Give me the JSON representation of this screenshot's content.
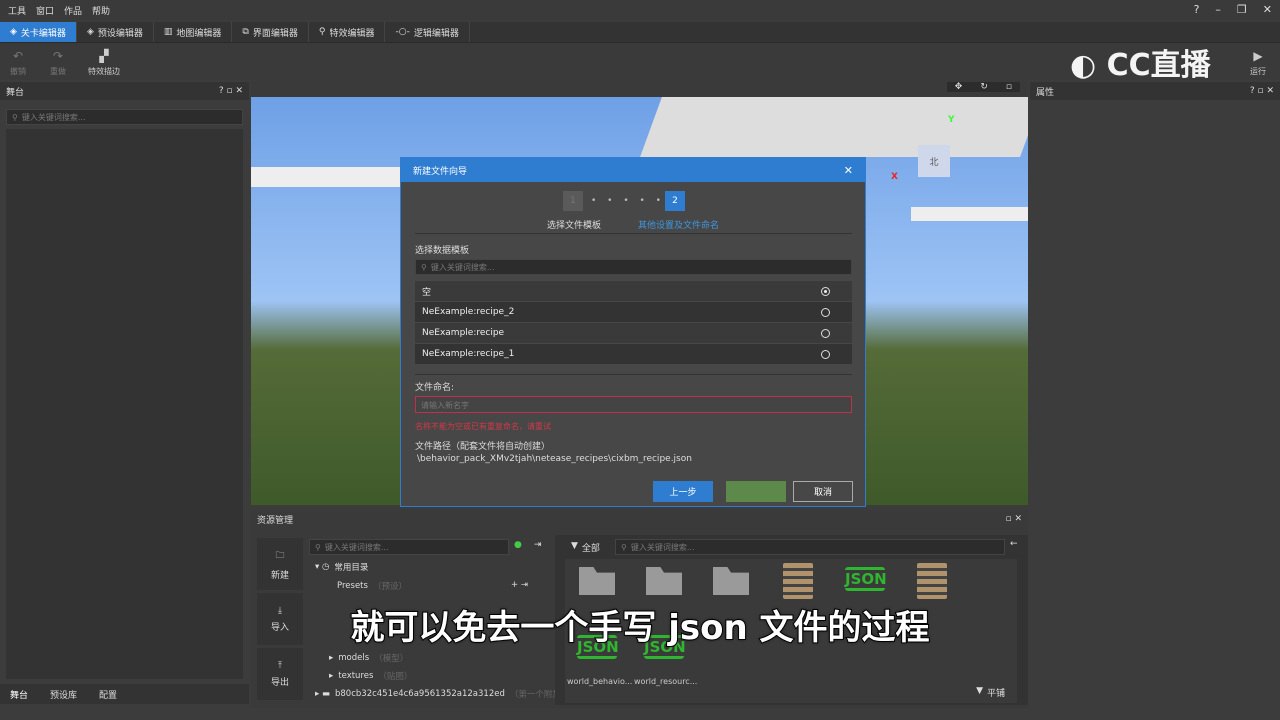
{
  "menu": [
    "工具",
    "窗口",
    "作品",
    "帮助"
  ],
  "window_controls": [
    "?",
    "–",
    "❐",
    "✕"
  ],
  "editor_tabs": [
    "关卡编辑器",
    "预设编辑器",
    "地图编辑器",
    "界面编辑器",
    "特效编辑器",
    "逻辑编辑器"
  ],
  "toolbar": {
    "undo": "撤销",
    "redo": "重做",
    "effect_outline": "特效描边",
    "run": "运行"
  },
  "stage": {
    "title": "舞台",
    "search_placeholder": "键入关键词搜索...",
    "bottom_tabs": [
      "舞台",
      "预设库",
      "配置"
    ]
  },
  "properties": {
    "title": "属性"
  },
  "viewport": {
    "compass": "北",
    "axis_x": "X",
    "axis_y": "Y"
  },
  "dialog": {
    "title": "新建文件向导",
    "step1_num": "1",
    "step2_num": "2",
    "step1_label": "选择文件模板",
    "step2_label": "其他设置及文件命名",
    "template_label": "选择数据模板",
    "search_placeholder": "键入关键词搜索...",
    "templates": [
      {
        "name": "空",
        "selected": true
      },
      {
        "name": "NeExample:recipe_2",
        "selected": false
      },
      {
        "name": "NeExample:recipe",
        "selected": false
      },
      {
        "name": "NeExample:recipe_1",
        "selected": false
      }
    ],
    "filename_label": "文件命名:",
    "filename_placeholder": "请输入新名字",
    "error": "名称不能为空或已有重复命名，请重试",
    "path_label": "文件路径（配套文件将自动创建）",
    "path": "\\behavior_pack_XMv2tjah\\netease_recipes\\cixbm_recipe.json",
    "prev": "上一步",
    "next": "",
    "cancel": "取消"
  },
  "resources": {
    "title": "资源管理",
    "side": [
      "新建",
      "导入",
      "导出"
    ],
    "search_placeholder": "键入关键词搜索...",
    "tree": {
      "common": "常用目录",
      "presets": "Presets",
      "presets_hint": "（预设）",
      "models": "models",
      "models_hint": "（模型）",
      "textures": "textures",
      "textures_hint": "（贴图）",
      "pack": "b80cb32c451e4c6a9561352a12a312ed",
      "pack_hint": "（第一个附加包）"
    },
    "filter_all": "全部",
    "assets": [
      "world_behavio...",
      "world_resourc..."
    ],
    "view_mode": "平铺"
  },
  "watermark": "CC直播",
  "subtitle": "就可以免去一个手写 json 文件的过程",
  "colors": {
    "accent": "#2f7dd1",
    "error": "#d0384a",
    "json": "#2fb52f"
  }
}
